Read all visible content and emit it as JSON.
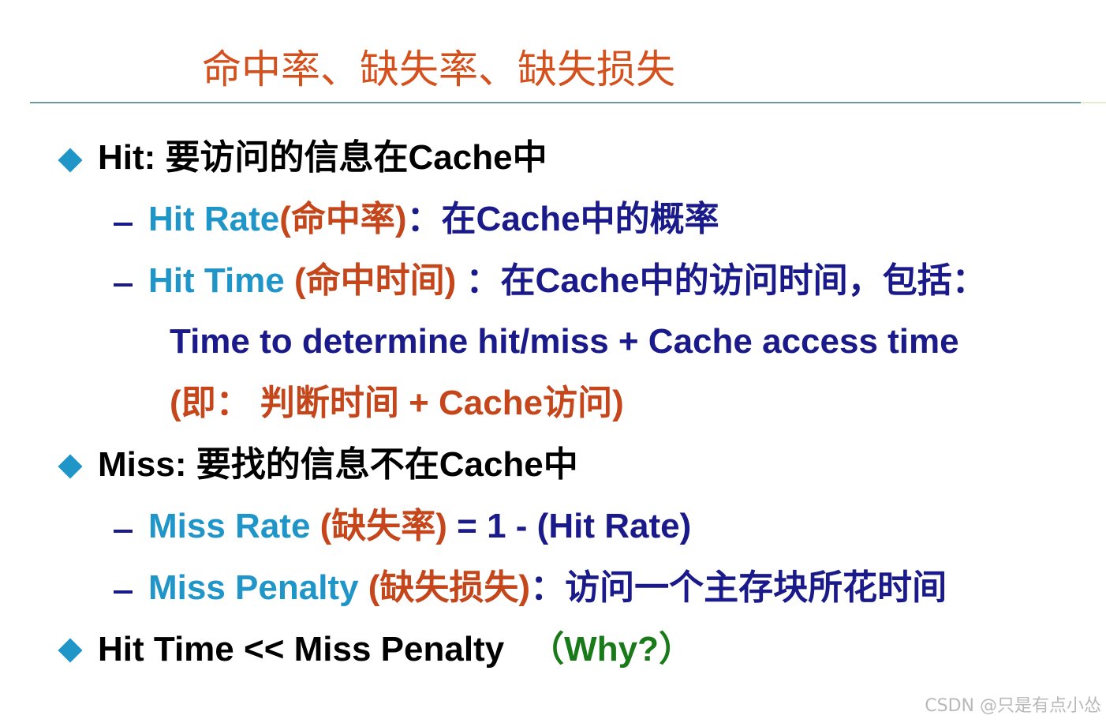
{
  "title": "命中率、缺失率、缺失损失",
  "bullets": {
    "hit": {
      "label": "Hit:",
      "desc": " 要访问的信息在Cache中"
    },
    "hit_rate": {
      "term": "Hit Rate",
      "cn": "(命中率)",
      "desc": "：在Cache中的概率"
    },
    "hit_time": {
      "term": "Hit Time ",
      "cn": "(命中时间)",
      "desc": " ：在Cache中的访问时间，包括：",
      "formula": "Time to determine hit/miss + Cache access time",
      "note": "(即：  判断时间 + Cache访问)"
    },
    "miss": {
      "label": "Miss:",
      "desc": " 要找的信息不在Cache中"
    },
    "miss_rate": {
      "term": "Miss Rate ",
      "cn": "(缺失率)",
      "desc": " = 1 - (Hit Rate)"
    },
    "miss_penalty": {
      "term": "Miss Penalty ",
      "cn": "(缺失损失)",
      "desc": "：访问一个主存块所花时间"
    },
    "compare": {
      "text": "Hit Time << Miss Penalty",
      "why": "（Why?）"
    }
  },
  "watermark": "CSDN @只是有点小怂",
  "colors": {
    "title": "#d4501c",
    "bullet_marker": "#1f95c8",
    "term": "#1f95c8",
    "chinese_term": "#c4461a",
    "description": "#1a1a8a",
    "why": "#1a7a1a",
    "rule": "#6f9d9a"
  },
  "icons": {
    "bullet": "diamond-icon",
    "sub_bullet": "dash-icon"
  }
}
